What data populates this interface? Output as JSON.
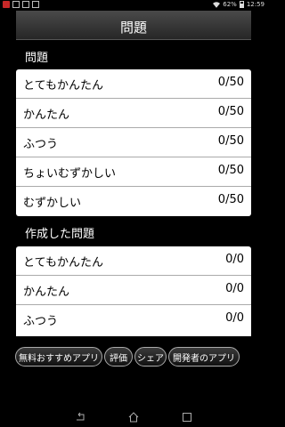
{
  "status_bar": {
    "battery_percent": "62%",
    "time": "12:59",
    "icons": [
      "notification-red-icon",
      "sim-icon",
      "storage-icon",
      "camera-icon",
      "wifi-icon",
      "battery-icon"
    ]
  },
  "header": {
    "title": "問題"
  },
  "sections": {
    "problems": {
      "title": "問題",
      "rows": [
        {
          "label": "とてもかんたん",
          "value": "0/50"
        },
        {
          "label": "かんたん",
          "value": "0/50"
        },
        {
          "label": "ふつう",
          "value": "0/50"
        },
        {
          "label": "ちょいむずかしい",
          "value": "0/50"
        },
        {
          "label": "むずかしい",
          "value": "0/50"
        }
      ]
    },
    "created": {
      "title": "作成した問題",
      "rows": [
        {
          "label": "とてもかんたん",
          "value": "0/0"
        },
        {
          "label": "かんたん",
          "value": "0/0"
        },
        {
          "label": "ふつう",
          "value": "0/0"
        }
      ]
    }
  },
  "buttons": {
    "free_apps": "無料おすすめアプリ",
    "rate": "評価",
    "share": "シェア",
    "developer_apps": "開発者のアプリ"
  },
  "nav_bar": {
    "icons": [
      "back-icon",
      "home-icon",
      "recents-icon"
    ]
  },
  "colors": {
    "background": "#000000",
    "list_bg": "#ffffff",
    "separator": "#aaaaaa"
  }
}
